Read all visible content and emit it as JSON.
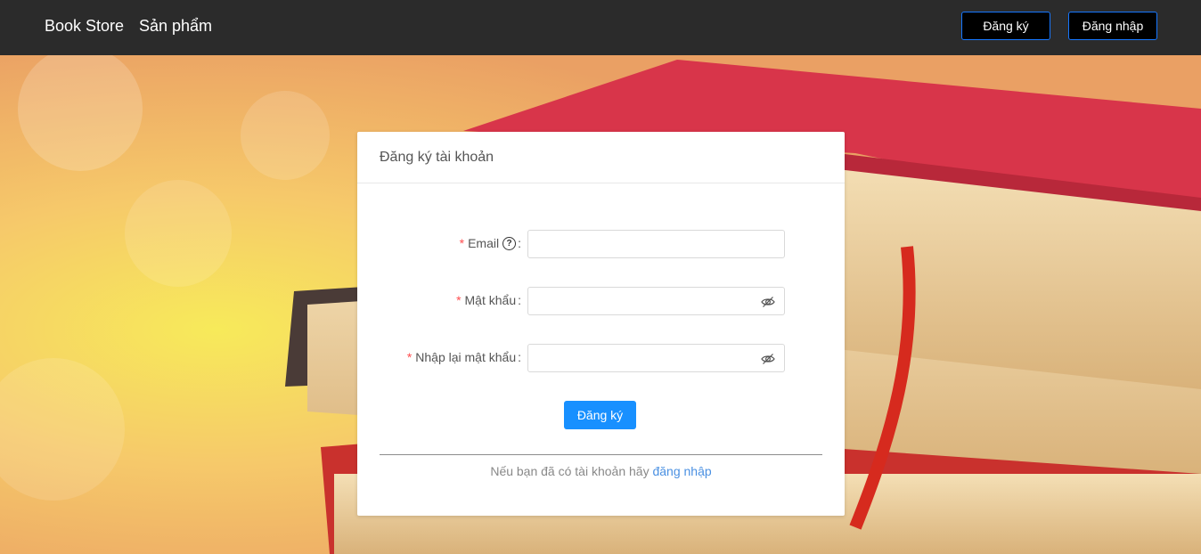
{
  "nav": {
    "brand": "Book Store",
    "products": "Sản phẩm",
    "register_button": "Đăng ký",
    "login_button": "Đăng nhập"
  },
  "form": {
    "title": "Đăng ký tài khoản",
    "email_label": "Email",
    "password_label": "Mật khẩu",
    "confirm_password_label": "Nhập lại mật khẩu",
    "required_mark": "*",
    "colon": ":",
    "help_glyph": "?",
    "email_value": "",
    "password_value": "",
    "confirm_password_value": "",
    "submit_label": "Đăng ký",
    "footer_text": "Nếu bạn đã có tài khoản hãy",
    "footer_link": "đăng nhập"
  },
  "icons": {
    "help": "question-circle-icon",
    "password_toggle": "eye-invisible-icon"
  },
  "colors": {
    "topbar": "#2b2b2b",
    "primary": "#1890ff",
    "required": "#ff4d4f",
    "link": "#4a90e2"
  }
}
